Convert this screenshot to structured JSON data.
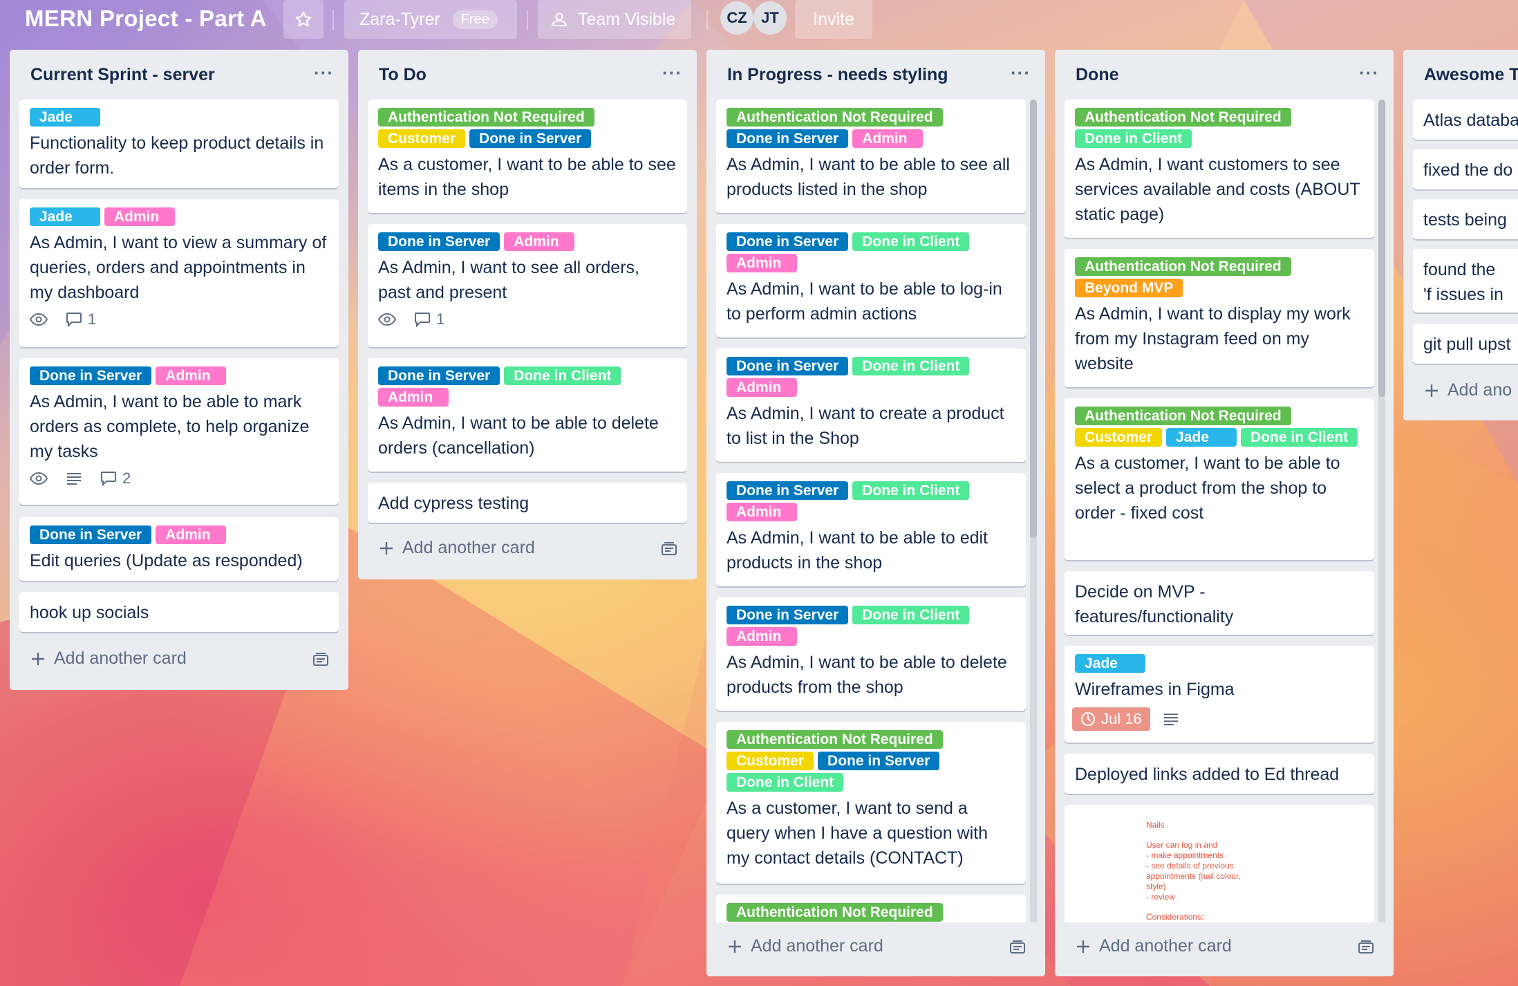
{
  "colors": {
    "green": "#61bd4f",
    "yellow": "#f2d600",
    "orange": "#ff9f1a",
    "blue": "#0079bf",
    "sky": "#00c2e0",
    "pink": "#ff78cb",
    "lime": "#51e898",
    "due_red": "#ec9488"
  },
  "header": {
    "board_title": "MERN Project - Part A",
    "star_icon": "star-icon",
    "workspace": "Zara-Tyrer",
    "plan_badge": "Free",
    "visibility": "Team Visible",
    "members": [
      "CZ",
      "JT"
    ],
    "invite": "Invite"
  },
  "lists": [
    {
      "title": "Current Sprint - server",
      "add_card": "Add another card",
      "cards": [
        {
          "labels": [
            "Jade"
          ],
          "text": "Functionality to keep product details in order form."
        },
        {
          "labels": [
            "Jade",
            "Admin"
          ],
          "text": "As Admin, I want to view a summary of queries, orders and appointments in my dashboard",
          "comments": "1"
        },
        {
          "labels": [
            "Done in Server",
            "Admin"
          ],
          "text": "As Admin, I want to be able to mark orders as complete, to help organize my tasks",
          "comments": "2"
        },
        {
          "labels": [
            "Done in Server",
            "Admin"
          ],
          "text": "Edit queries (Update as responded)"
        },
        {
          "labels": [],
          "text": "hook up socials"
        }
      ]
    },
    {
      "title": "To Do",
      "add_card": "Add another card",
      "cards": [
        {
          "labels": [
            "Authentication Not Required",
            "Customer",
            "Done in Server"
          ],
          "text": "As a customer, I want to be able to see items in the shop"
        },
        {
          "labels": [
            "Done in Server",
            "Admin"
          ],
          "text": "As Admin, I want to see all orders, past and present",
          "comments": "1"
        },
        {
          "labels": [
            "Done in Server",
            "Done in Client",
            "Admin"
          ],
          "text": "As Admin, I want to be able to delete orders (cancellation)"
        },
        {
          "labels": [],
          "text": "Add cypress testing"
        }
      ]
    },
    {
      "title": "In Progress - needs styling",
      "add_card": "Add another card",
      "cards": [
        {
          "labels": [
            "Authentication Not Required",
            "Done in Server",
            "Admin"
          ],
          "text": "As Admin, I want to be able to see all products listed in the shop"
        },
        {
          "labels": [
            "Done in Server",
            "Done in Client",
            "Admin"
          ],
          "text": "As Admin, I want to be able to log-in to perform admin actions"
        },
        {
          "labels": [
            "Done in Server",
            "Done in Client",
            "Admin"
          ],
          "text": "As Admin, I want to create a product to list in the Shop"
        },
        {
          "labels": [
            "Done in Server",
            "Done in Client",
            "Admin"
          ],
          "text": "As Admin, I want to be able to edit products in the shop"
        },
        {
          "labels": [
            "Done in Server",
            "Done in Client",
            "Admin"
          ],
          "text": "As Admin, I want to be able to delete products from the shop"
        },
        {
          "labels": [
            "Authentication Not Required",
            "Customer",
            "Done in Server",
            "Done in Client"
          ],
          "text": "As a customer, I want to send a query when I have a question with my contact details (CONTACT)"
        },
        {
          "labels": [
            "Authentication Not Required"
          ],
          "text": ""
        }
      ]
    },
    {
      "title": "Done",
      "add_card": "Add another card",
      "cards": [
        {
          "labels": [
            "Authentication Not Required",
            "Done in Client"
          ],
          "text": "As Admin, I want customers to see services available and costs (ABOUT static page)"
        },
        {
          "labels": [
            "Authentication Not Required",
            "Beyond MVP"
          ],
          "text": "As Admin, I want to display my work from my Instagram feed on my website"
        },
        {
          "labels": [
            "Authentication Not Required",
            "Customer",
            "Jade",
            "Done in Client"
          ],
          "text": "As a customer, I want to be able to select a product from the shop to order - fixed cost"
        },
        {
          "labels": [],
          "text": "Decide on MVP - features/functionality"
        },
        {
          "labels": [
            "Jade"
          ],
          "text": "Wireframes in Figma",
          "due": "Jul 16"
        },
        {
          "labels": [],
          "text": "Deployed links added to Ed thread"
        },
        {
          "labels": [],
          "text": "",
          "cover_notes": {
            "title": "Nails",
            "lines": [
              "User can log in and",
              "- make appointments",
              "- see details of previous",
              "appointments (nail colour,",
              "style)",
              "- review"
            ],
            "more": "Considerations:"
          }
        }
      ]
    },
    {
      "title": "Awesome T",
      "add_card": "Add ano",
      "cards": [
        {
          "labels": [],
          "text": "Atlas databa"
        },
        {
          "labels": [],
          "text": "fixed the do"
        },
        {
          "labels": [],
          "text": "tests being"
        },
        {
          "labels": [],
          "text": "found the 'f issues in the"
        },
        {
          "labels": [],
          "text": "git pull upst"
        }
      ]
    }
  ]
}
